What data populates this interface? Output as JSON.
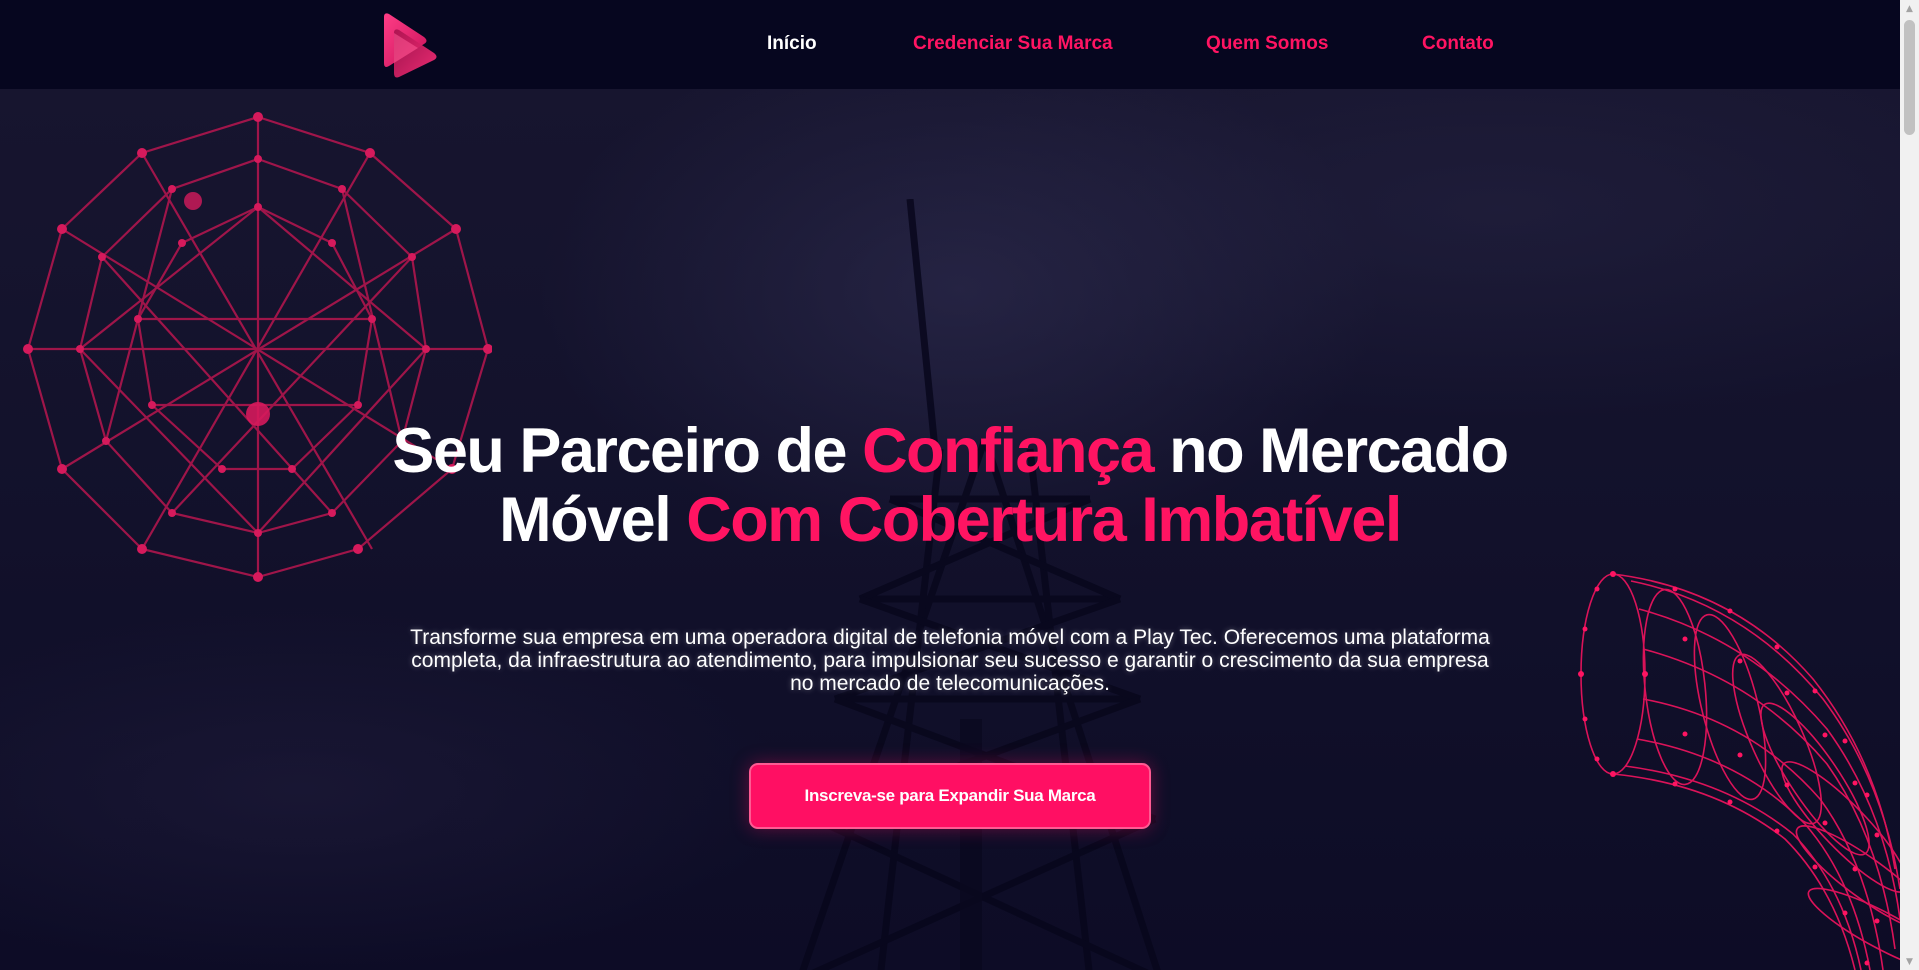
{
  "header": {
    "logo_alt": "Play Tec",
    "nav": {
      "home": "Início",
      "credential": "Credenciar Sua Marca",
      "about": "Quem Somos",
      "contact": "Contato"
    }
  },
  "hero": {
    "title_part1": "Seu Parceiro de ",
    "title_highlight1": "Confiança",
    "title_part2": " no Mercado",
    "title_part3": "Móvel ",
    "title_highlight2": "Com Cobertura Imbatível",
    "description": "Transforme sua empresa em uma operadora digital de telefonia móvel com a Play Tec. Oferecemos uma plataforma completa, da infraestrutura ao atendimento, para impulsionar seu sucesso e garantir o crescimento da sua empresa no mercado de telecomunicações.",
    "cta_label": "Inscreva-se para Expandir Sua Marca"
  },
  "colors": {
    "accent": "#ff1462",
    "header_bg": "#06061f",
    "hero_bg": "#13122c",
    "nav_active": "#ffffff"
  },
  "icons": {
    "logo": "play-logo-icon",
    "scroll_up": "arrow-up-icon",
    "scroll_down": "arrow-down-icon"
  }
}
